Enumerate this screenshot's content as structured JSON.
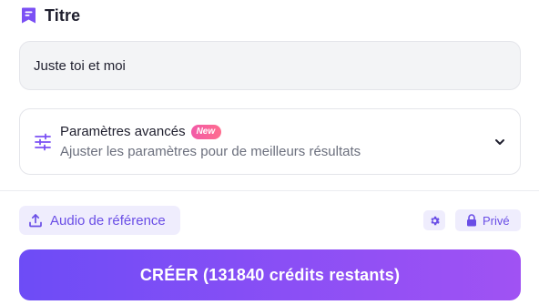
{
  "title_section": {
    "icon": "bookmark-icon",
    "label": "Titre"
  },
  "title_input": {
    "value": "Juste toi et moi"
  },
  "advanced": {
    "icon": "sliders-icon",
    "title": "Paramètres avancés",
    "badge": "New",
    "subtitle": "Ajuster les paramètres pour de meilleurs résultats",
    "chevron": "chevron-down-icon"
  },
  "reference_audio": {
    "icon": "upload-icon",
    "label": "Audio de référence"
  },
  "settings": {
    "icon": "gear-icon"
  },
  "privacy": {
    "icon": "lock-icon",
    "label": "Privé"
  },
  "create_button": {
    "label": "CRÉER (131840 crédits restants)"
  },
  "colors": {
    "accent": "#7C4DF7",
    "accent_light": "#EFEDFD",
    "badge_pink": "#F25AA8",
    "input_bg": "#F3F4F6"
  }
}
